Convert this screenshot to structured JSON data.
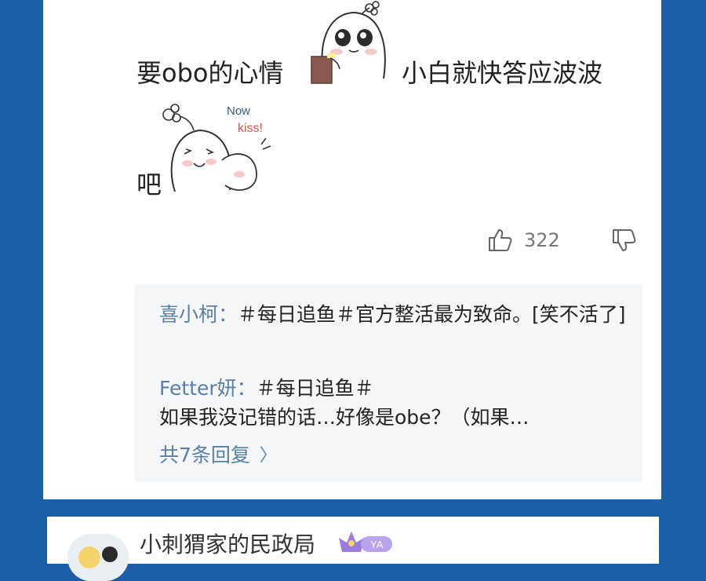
{
  "comment": {
    "text_before_sticker": "要obo的心情",
    "text_after_sticker": "小白就快答应波波",
    "text_line2": "吧",
    "sticker1": "shy-ghost-holding-book-sticker",
    "sticker2": "ghost-now-kiss-sticker",
    "sticker2_text_now": "Now",
    "sticker2_text_kiss": "kiss!",
    "like_count": "322"
  },
  "replies": [
    {
      "user": "喜小柯：",
      "text": "＃每日追鱼＃官方整活最为致命。[笑不活了]"
    },
    {
      "user": "Fetter妍：",
      "text_line1": "＃每日追鱼＃",
      "text_line2": "如果我没记错的话…好像是obe？（如果…"
    }
  ],
  "more_replies_label": "共7条回复",
  "next_comment": {
    "username": "小刺猬家的民政局",
    "badge_text": "YA"
  },
  "colors": {
    "background": "#1a5fa8",
    "reply_user": "#5a7fa6",
    "reply_box": "#f4f6f8"
  }
}
